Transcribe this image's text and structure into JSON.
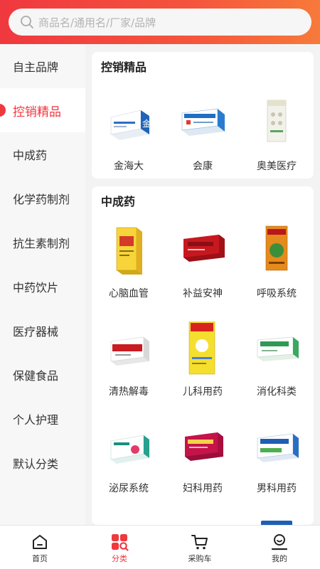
{
  "search": {
    "placeholder": "商品名/通用名/厂家/品牌"
  },
  "sidebar": {
    "items": [
      {
        "label": "自主品牌",
        "active": false
      },
      {
        "label": "控销精品",
        "active": true
      },
      {
        "label": "中成药",
        "active": false
      },
      {
        "label": "化学药制剂",
        "active": false
      },
      {
        "label": "抗生素制剂",
        "active": false
      },
      {
        "label": "中药饮片",
        "active": false
      },
      {
        "label": "医疗器械",
        "active": false
      },
      {
        "label": "保健食品",
        "active": false
      },
      {
        "label": "个人护理",
        "active": false
      },
      {
        "label": "默认分类",
        "active": false
      }
    ]
  },
  "sections": [
    {
      "title": "控销精品",
      "items": [
        {
          "label": "金海大",
          "icon": "blue-white-medicine-box-icon"
        },
        {
          "label": "会康",
          "icon": "blue-medicine-box-icon"
        },
        {
          "label": "奥美医疗",
          "icon": "bandage-pack-icon"
        }
      ]
    },
    {
      "title": "中成药",
      "items": [
        {
          "label": "心脑血管",
          "icon": "yellow-medicine-box-icon"
        },
        {
          "label": "补益安神",
          "icon": "red-medicine-box-icon"
        },
        {
          "label": "呼吸系统",
          "icon": "orange-medicine-box-icon"
        },
        {
          "label": "清热解毒",
          "icon": "red-white-medicine-box-icon"
        },
        {
          "label": "儿科用药",
          "icon": "yellow-children-medicine-box-icon"
        },
        {
          "label": "消化科类",
          "icon": "green-white-medicine-box-icon"
        },
        {
          "label": "泌尿系统",
          "icon": "teal-white-medicine-box-icon"
        },
        {
          "label": "妇科用药",
          "icon": "magenta-medicine-box-icon"
        },
        {
          "label": "男科用药",
          "icon": "blue-green-medicine-box-icon"
        }
      ]
    }
  ],
  "tabbar": {
    "items": [
      {
        "label": "首页",
        "icon": "home-icon",
        "active": false
      },
      {
        "label": "分类",
        "icon": "category-icon",
        "active": true
      },
      {
        "label": "采购车",
        "icon": "cart-icon",
        "active": false
      },
      {
        "label": "我的",
        "icon": "user-icon",
        "active": false
      }
    ]
  },
  "colors": {
    "accent": "#f0383f",
    "gradient_end": "#f77a3a",
    "background": "#f3f3f3"
  }
}
